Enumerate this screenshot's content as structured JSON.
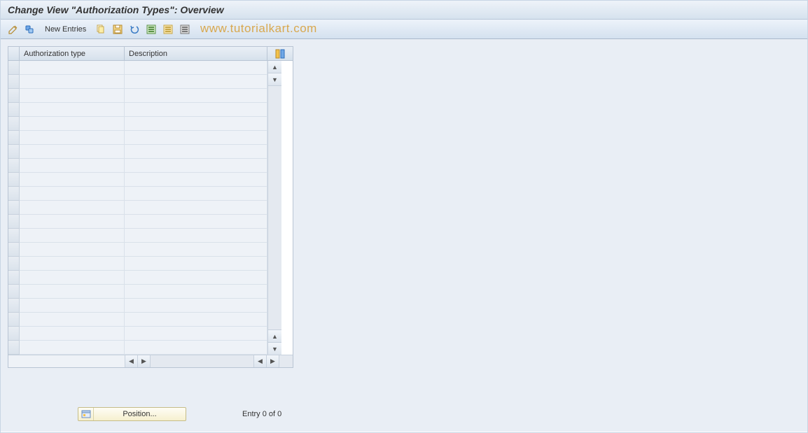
{
  "title": "Change View \"Authorization Types\": Overview",
  "toolbar": {
    "new_entries": "New Entries"
  },
  "watermark": "www.tutorialkart.com",
  "table": {
    "columns": [
      "Authorization type",
      "Description"
    ],
    "row_count": 21
  },
  "footer": {
    "position_label": "Position...",
    "entry_text": "Entry 0 of 0"
  }
}
